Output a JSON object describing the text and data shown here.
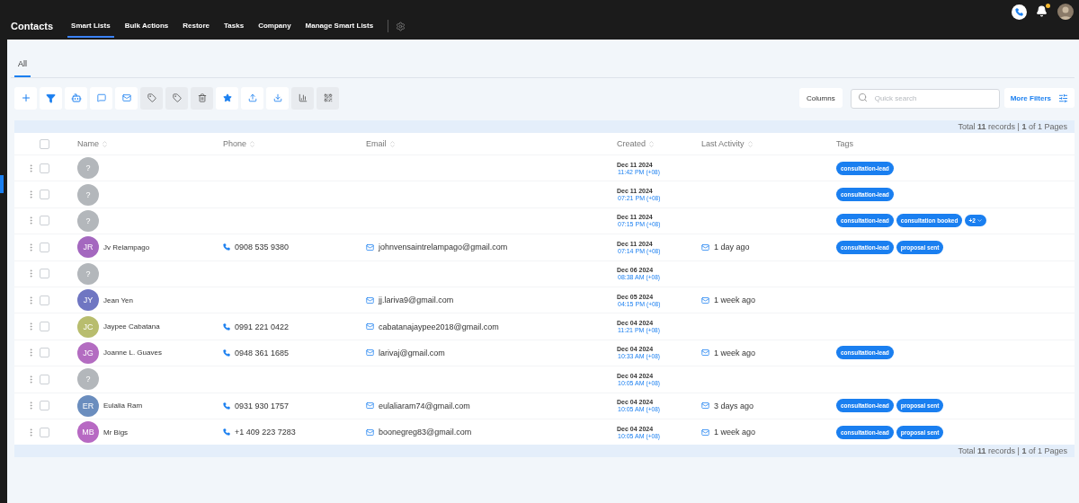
{
  "header": {
    "title": "Contacts",
    "nav": [
      {
        "label": "Smart Lists",
        "selected": true
      },
      {
        "label": "Bulk Actions",
        "selected": false
      },
      {
        "label": "Restore",
        "selected": false
      },
      {
        "label": "Tasks",
        "selected": false
      },
      {
        "label": "Company",
        "selected": false
      },
      {
        "label": "Manage Smart Lists",
        "selected": false
      }
    ],
    "notification_dot": true
  },
  "list_tabs": [
    {
      "label": "All",
      "selected": true
    }
  ],
  "toolbar": [
    {
      "kind": "add",
      "disabled": false
    },
    {
      "kind": "filter",
      "disabled": false
    },
    {
      "kind": "automation",
      "disabled": false
    },
    {
      "kind": "sms",
      "disabled": false
    },
    {
      "kind": "email",
      "disabled": false
    },
    {
      "kind": "add-tag",
      "disabled": true
    },
    {
      "kind": "remove-tag",
      "disabled": true
    },
    {
      "kind": "delete",
      "disabled": true
    },
    {
      "kind": "star",
      "disabled": false
    },
    {
      "kind": "import",
      "disabled": false
    },
    {
      "kind": "export",
      "disabled": false
    },
    {
      "kind": "chart",
      "disabled": true
    },
    {
      "kind": "merge",
      "disabled": true
    }
  ],
  "columns_button": "Columns",
  "search": {
    "placeholder": "Quick search"
  },
  "more_filters": "More Filters",
  "pagination_top": "Total **11** records | **1** of 1 Pages",
  "pagination_bottom": "Total **11** records | **1** of 1 Pages",
  "table": {
    "header_checked": false,
    "columns": [
      {
        "label": "Name",
        "sortable": true
      },
      {
        "label": "Phone",
        "sortable": true
      },
      {
        "label": "Email",
        "sortable": true
      },
      {
        "label": "Created",
        "sortable": true
      },
      {
        "label": "Last Activity",
        "sortable": true
      },
      {
        "label": "Tags",
        "sortable": false
      }
    ],
    "rows": [
      {
        "selected": false,
        "initials": "?",
        "color": "#b3b7bb",
        "created_date": "Dec 11 2024",
        "created_time": "11:42 PM",
        "tz": "(+08)",
        "tags": [
          "consultation-lead"
        ]
      },
      {
        "selected": false,
        "initials": "?",
        "color": "#b3b7bb",
        "created_date": "Dec 11 2024",
        "created_time": "07:21 PM",
        "tz": "(+08)",
        "tags": [
          "consultation-lead"
        ]
      },
      {
        "selected": false,
        "initials": "?",
        "color": "#b3b7bb",
        "created_date": "Dec 11 2024",
        "created_time": "07:15 PM",
        "tz": "(+08)",
        "tags": [
          "consultation-lead",
          "consultation booked"
        ],
        "more_tags": "+2"
      },
      {
        "selected": false,
        "initials": "JR",
        "color": "#a468bf",
        "name": "Jv Relampago",
        "phone": "0908 535 9380",
        "email": "johnvensaintrelampago@gmail.com",
        "created_date": "Dec 11 2024",
        "created_time": "07:14 PM",
        "tz": "(+08)",
        "activity": "1 day ago",
        "tags": [
          "consultation-lead",
          "proposal sent"
        ]
      },
      {
        "selected": false,
        "initials": "?",
        "color": "#b3b7bb",
        "created_date": "Dec 06 2024",
        "created_time": "08:38 AM",
        "tz": "(+08)"
      },
      {
        "selected": false,
        "initials": "JY",
        "color": "#6f76c2",
        "name": "Jean Yen",
        "email": "jj.lariva9@gmail.com",
        "created_date": "Dec 05 2024",
        "created_time": "04:15 PM",
        "tz": "(+08)",
        "activity": "1 week ago"
      },
      {
        "selected": false,
        "initials": "JC",
        "color": "#b8bd6e",
        "name": "Jaypee Cabatana",
        "phone": "0991 221 0422",
        "email": "cabatanajaypee2018@gmail.com",
        "created_date": "Dec 04 2024",
        "created_time": "11:21 PM",
        "tz": "(+08)"
      },
      {
        "selected": false,
        "initials": "JG",
        "color": "#b36cc1",
        "name": "Joanne L. Guaves",
        "phone": "0948 361 1685",
        "email": "larivaj@gmail.com",
        "created_date": "Dec 04 2024",
        "created_time": "10:33 AM",
        "tz": "(+08)",
        "activity": "1 week ago",
        "tags": [
          "consultation-lead"
        ]
      },
      {
        "selected": false,
        "initials": "?",
        "color": "#b3b7bb",
        "created_date": "Dec 04 2024",
        "created_time": "10:05 AM",
        "tz": "(+08)"
      },
      {
        "selected": false,
        "initials": "ER",
        "color": "#6a8dbe",
        "name": "Eulalia Ram",
        "phone": "0931 930 1757",
        "email": "eulaliaram74@gmail.com",
        "created_date": "Dec 04 2024",
        "created_time": "10:05 AM",
        "tz": "(+08)",
        "activity": "3 days ago",
        "tags": [
          "consultation-lead",
          "proposal sent"
        ]
      },
      {
        "selected": false,
        "initials": "MB",
        "color": "#b769c3",
        "name": "Mr Bigs",
        "phone": "+1 409 223 7283",
        "email": "boonegreg83@gmail.com",
        "created_date": "Dec 04 2024",
        "created_time": "10:05 AM",
        "tz": "(+08)",
        "activity": "1 week ago",
        "tags": [
          "consultation-lead",
          "proposal sent"
        ]
      }
    ]
  }
}
